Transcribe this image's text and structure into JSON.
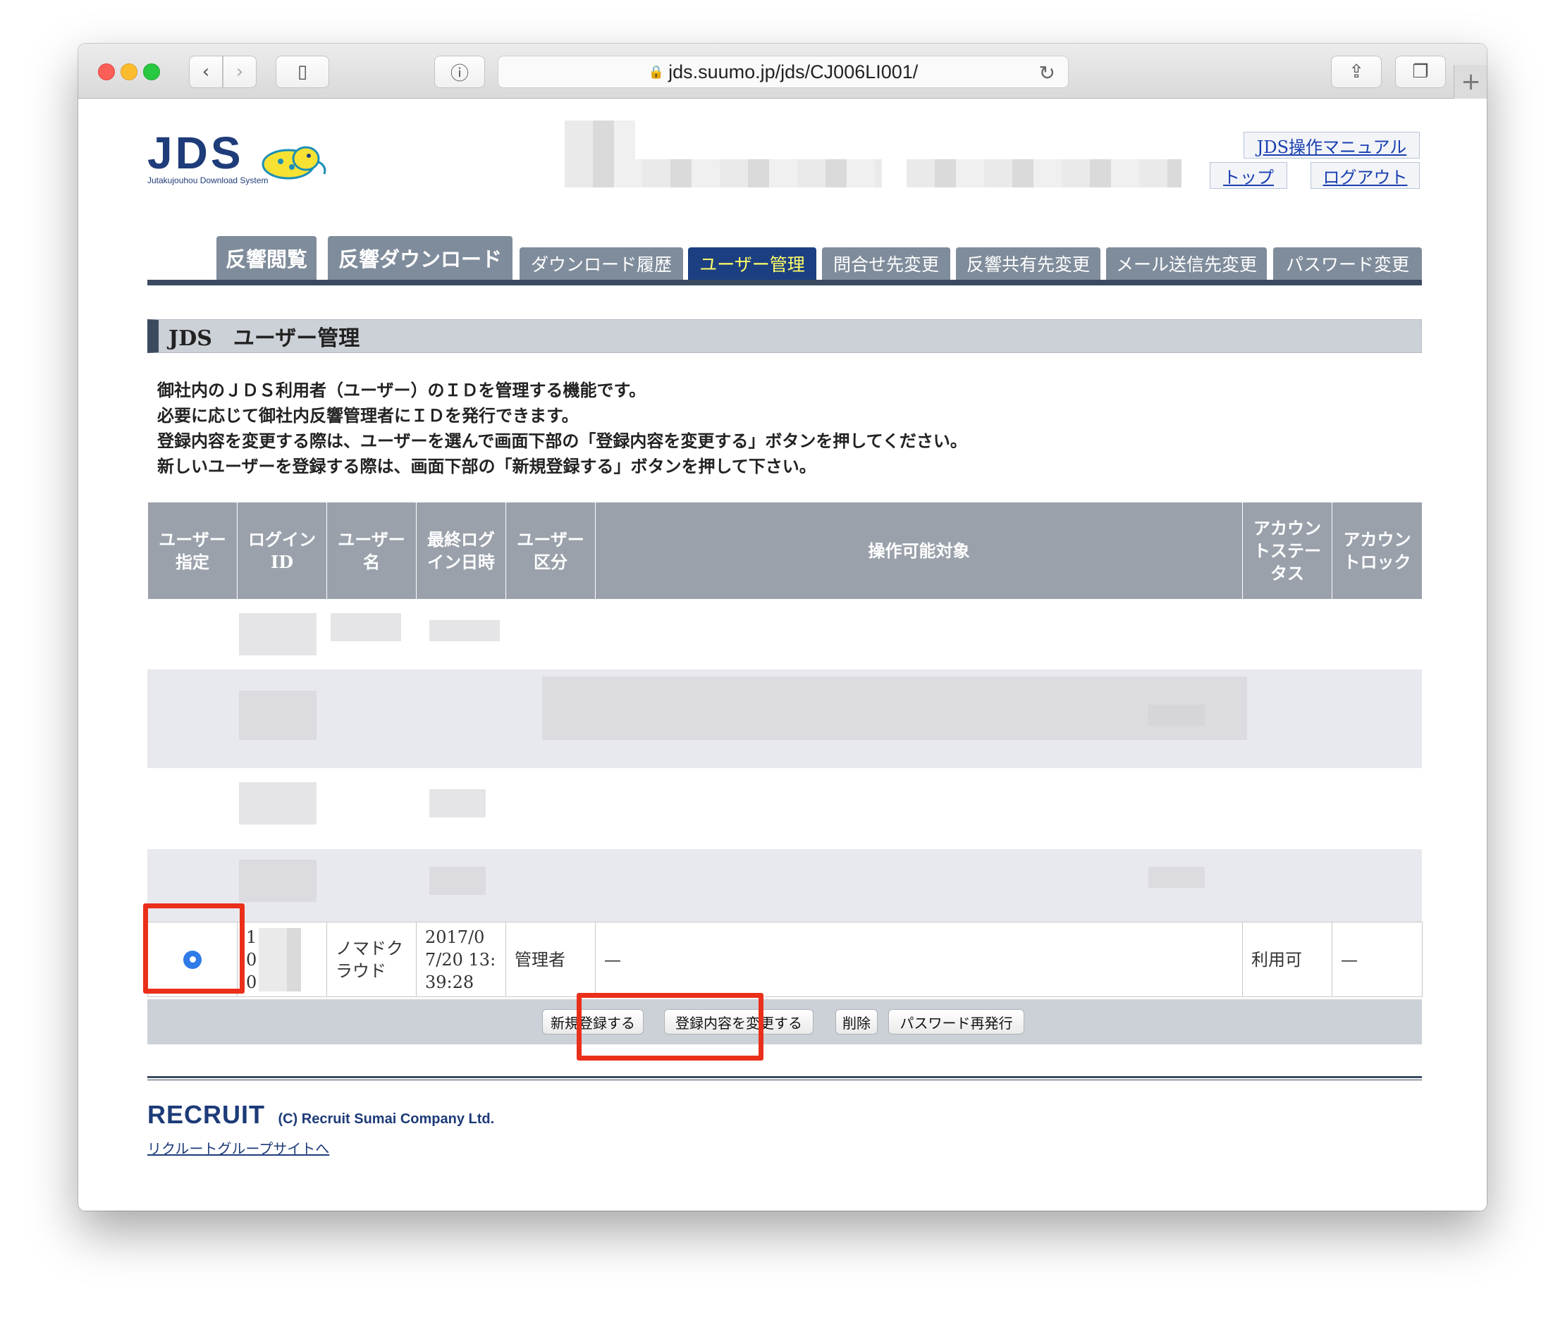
{
  "browser": {
    "url": "jds.suumo.jp/jds/CJ006LI001/",
    "new_tab": "+"
  },
  "header": {
    "logo_text": "JDS",
    "logo_sub": "Jutakujouhou Download System",
    "manual_link": "JDS操作マニュアル",
    "top_link": "トップ",
    "logout_link": "ログアウト"
  },
  "tabs": [
    {
      "label": "反響閲覧"
    },
    {
      "label": "反響ダウンロード"
    },
    {
      "label": "ダウンロード履歴"
    },
    {
      "label": "ユーザー管理"
    },
    {
      "label": "問合せ先変更"
    },
    {
      "label": "反響共有先変更"
    },
    {
      "label": "メール送信先変更"
    },
    {
      "label": "パスワード変更"
    }
  ],
  "section_title": "JDS　ユーザー管理",
  "description": [
    "御社内のＪＤＳ利用者（ユーザー）のＩＤを管理する機能です。",
    "必要に応じて御社内反響管理者にＩＤを発行できます。",
    "登録内容を変更する際は、ユーザーを選んで画面下部の「登録内容を変更する」ボタンを押してください。",
    "新しいユーザーを登録する際は、画面下部の「新規登録する」ボタンを押して下さい。"
  ],
  "table": {
    "headers": [
      "ユーザー指定",
      "ログインID",
      "ユーザー名",
      "最終ログイン日時",
      "ユーザー区分",
      "操作可能対象",
      "アカウントステータス",
      "アカウントロック"
    ],
    "visible_row": {
      "login_id": "1\n0\n0",
      "user_name": "ノマドクラウド",
      "last_login": "2017/07/20 13:39:28",
      "user_type": "管理者",
      "target": "—",
      "status": "利用可",
      "lock": "—"
    }
  },
  "buttons": {
    "new": "新規登録する",
    "edit": "登録内容を変更する",
    "delete": "削除",
    "reissue": "パスワード再発行"
  },
  "footer": {
    "brand": "RECRUIT",
    "copyright": "(C) Recruit Sumai Company Ltd.",
    "group_link": "リクルートグループサイトへ"
  },
  "colors": {
    "highlight": "#ea2f1b",
    "nav_dark": "#3b4a5f",
    "tab_active": "#1c3f82"
  }
}
